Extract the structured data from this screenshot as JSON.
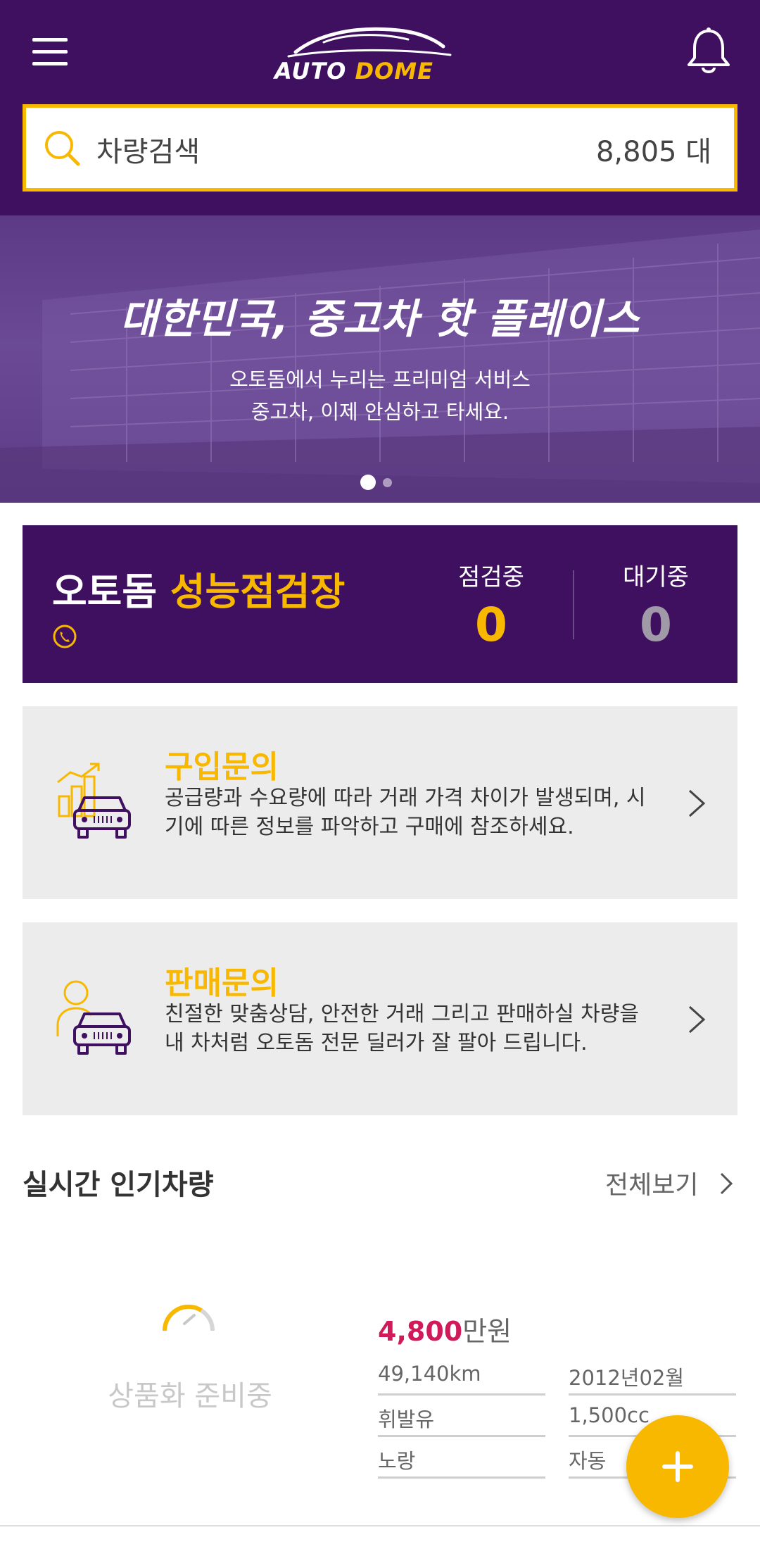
{
  "header": {
    "logo_part1": "AUTO",
    "logo_part2": "DOME",
    "menu_icon": "hamburger-menu-icon",
    "bell_icon": "bell-icon"
  },
  "search": {
    "label": "차량검색",
    "count": "8,805 대",
    "icon": "search-icon"
  },
  "banner": {
    "title": "대한민국, 중고차 핫 플레이스",
    "subtitle_line1": "오토돔에서 누리는 프리미엄 서비스",
    "subtitle_line2": "중고차, 이제 안심하고 타세요.",
    "slide_index": 1,
    "slide_count": 2
  },
  "inspection": {
    "title_prefix": "오토돔",
    "title_accent": "성능점검장",
    "phone_icon": "phone-icon",
    "stats": [
      {
        "label": "점검중",
        "value": "0"
      },
      {
        "label": "대기중",
        "value": "0"
      }
    ]
  },
  "inquiries": [
    {
      "title": "구입문의",
      "description": "공급량과 수요량에 따라 거래 가격 차이가 발생되며, 시기에 따른 정보를 파악하고 구매에 참조하세요.",
      "icon": "chart-car-icon"
    },
    {
      "title": "판매문의",
      "description": "친절한 맞춤상담, 안전한 거래 그리고 판매하실 차량을 내 차처럼 오토돔 전문 딜러가 잘 팔아 드립니다.",
      "icon": "person-car-icon"
    }
  ],
  "popular": {
    "title": "실시간 인기차량",
    "view_all": "전체보기",
    "car": {
      "preparing_text": "상품화 준비중",
      "price_number": "4,800",
      "price_unit": "만원",
      "mileage": "49,140km",
      "registration": "2012년02월",
      "fuel": "휘발유",
      "displacement": "1,500cc",
      "color": "노랑",
      "transmission": "자동"
    }
  },
  "fab": {
    "icon": "plus-icon"
  },
  "colors": {
    "brand_purple": "#3f1060",
    "accent_yellow": "#f9b800",
    "price_red": "#d01a5a"
  }
}
